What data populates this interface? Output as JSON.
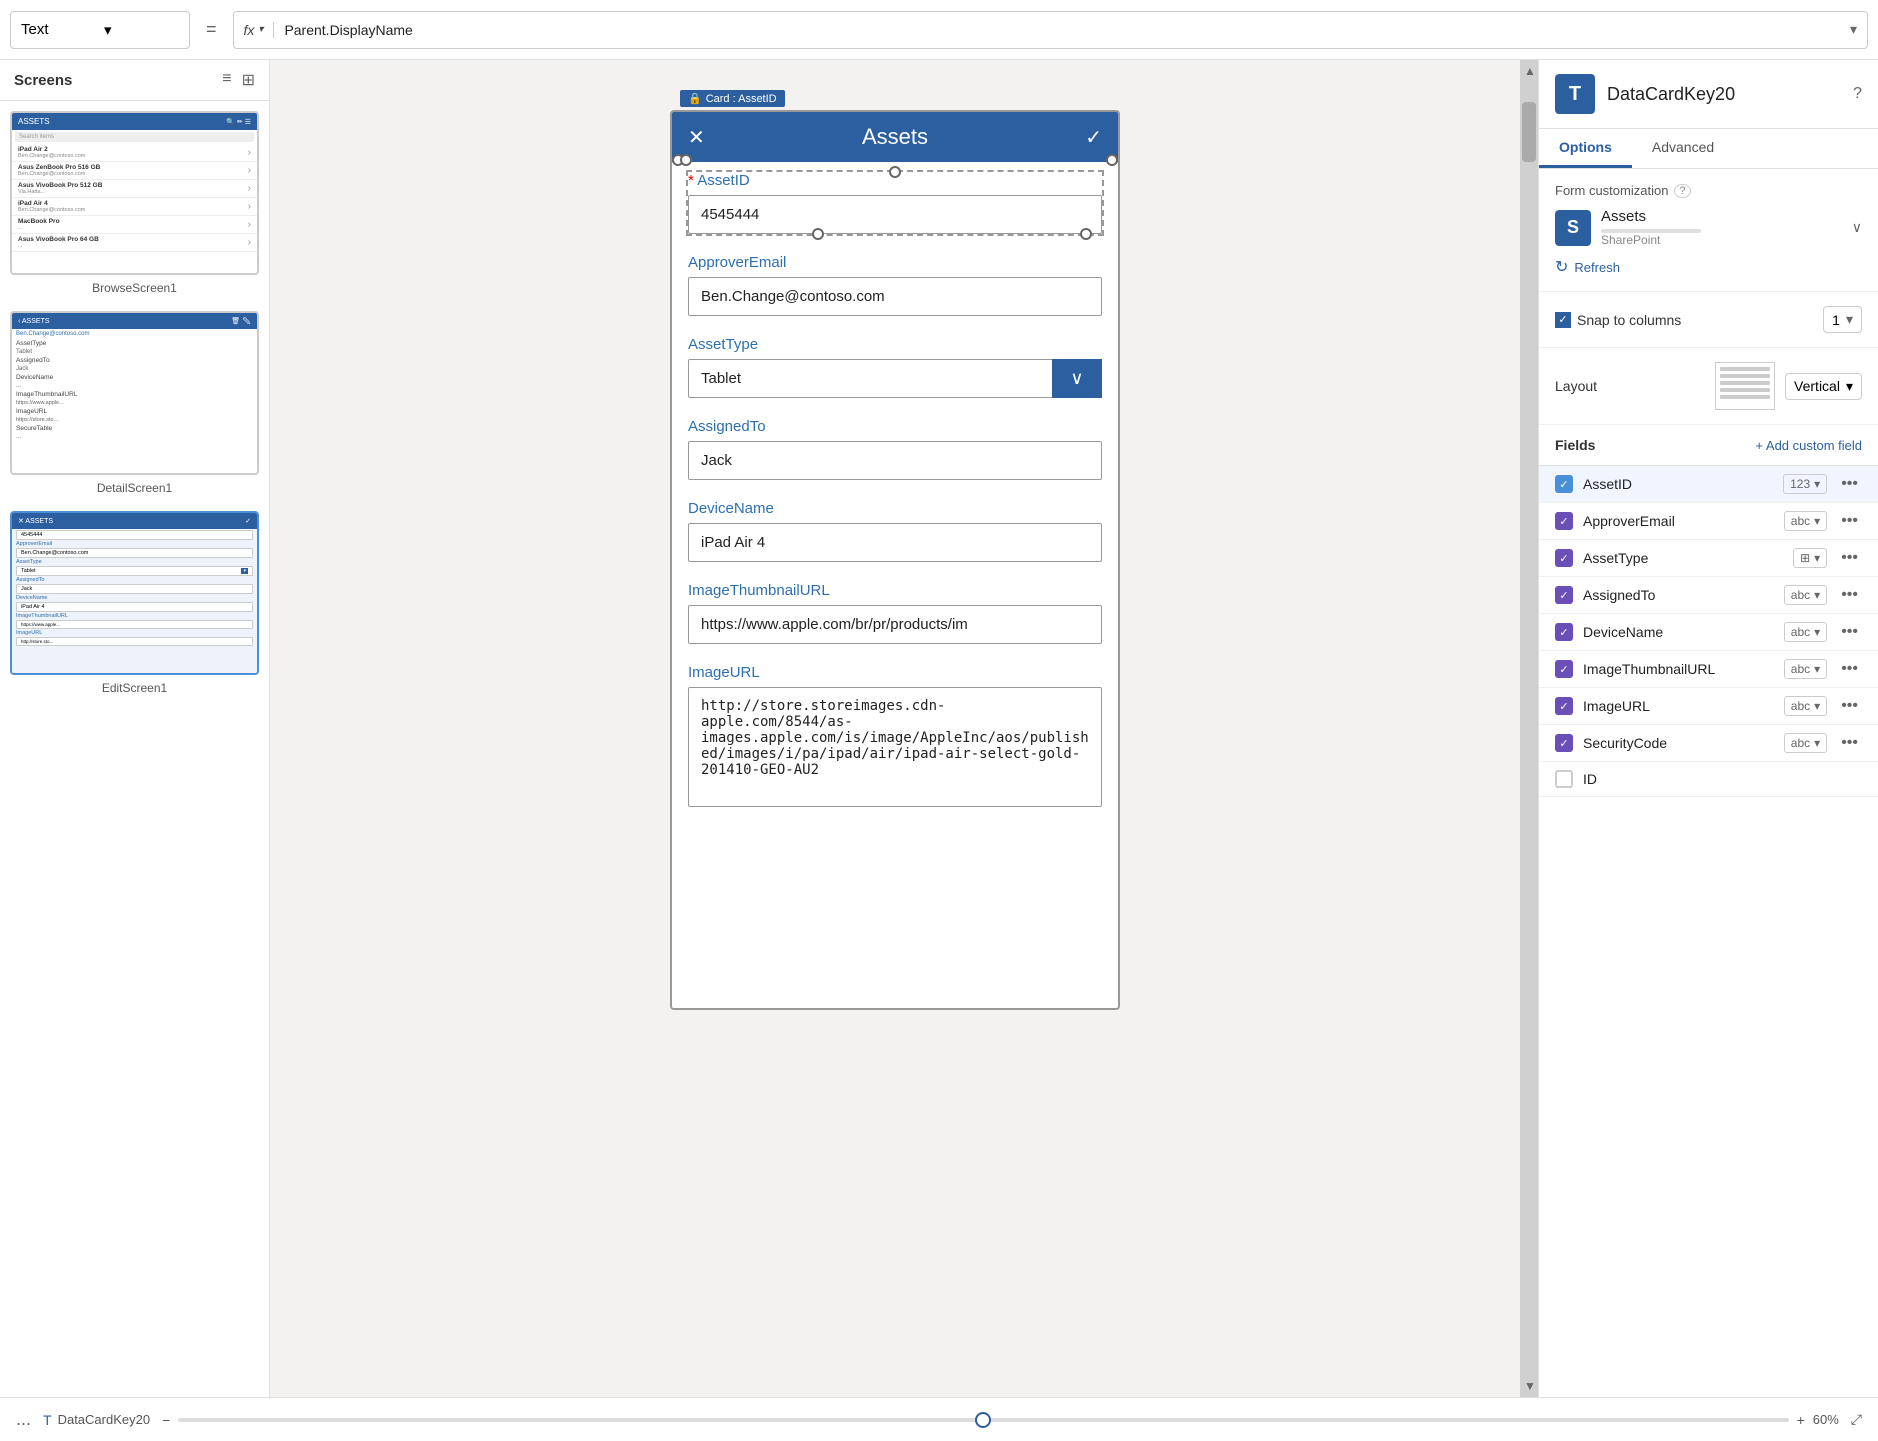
{
  "toolbar": {
    "formula_type": "Text",
    "formula_dropdown_arrow": "▾",
    "equals": "=",
    "fx_label": "fx",
    "fx_dropdown_arrow": "▾",
    "formula_value": "Parent.DisplayName",
    "formula_arrow": "▾"
  },
  "sidebar": {
    "title": "Screens",
    "list_icon": "≡",
    "grid_icon": "⊞",
    "screens": [
      {
        "name": "BrowseScreen1",
        "type": "browse"
      },
      {
        "name": "DetailScreen1",
        "type": "detail"
      },
      {
        "name": "EditScreen1",
        "type": "edit",
        "active": true
      }
    ]
  },
  "phone": {
    "card_badge": "Card : AssetID",
    "lock_icon": "🔒",
    "header_x": "✕",
    "header_title": "Assets",
    "header_check": "✓",
    "fields": [
      {
        "label": "AssetID",
        "required": true,
        "value": "4545444",
        "type": "input"
      },
      {
        "label": "ApproverEmail",
        "required": false,
        "value": "Ben.Change@contoso.com",
        "type": "input"
      },
      {
        "label": "AssetType",
        "required": false,
        "value": "Tablet",
        "type": "select"
      },
      {
        "label": "AssignedTo",
        "required": false,
        "value": "Jack",
        "type": "input"
      },
      {
        "label": "DeviceName",
        "required": false,
        "value": "iPad Air 4",
        "type": "input"
      },
      {
        "label": "ImageThumbnailURL",
        "required": false,
        "value": "https://www.apple.com/br/pr/products/im",
        "type": "input"
      },
      {
        "label": "ImageURL",
        "required": false,
        "value": "http://store.storeimages.cdn-apple.com/8544/as-images.apple.com/is/image/AppleInc/aos/published/images/i/pa/ipad/air/ipad-air-select-gold-201410-GEO-AU2",
        "type": "textarea"
      }
    ]
  },
  "right_panel": {
    "title": "DataCardKey20",
    "help_icon": "?",
    "tabs": [
      "Options",
      "Advanced"
    ],
    "active_tab": "Options",
    "form_customization_label": "Form customization",
    "help_circle": "?",
    "datasource": {
      "name": "Assets",
      "type": "SharePoint",
      "icon_letter": "S"
    },
    "expand_arrow": "∨",
    "refresh_label": "Refresh",
    "refresh_icon": "↻",
    "snap_label": "Snap to columns",
    "columns_value": "1",
    "layout_label": "Layout",
    "layout_value": "Vertical",
    "fields_title": "Fields",
    "add_custom_field": "+ Add custom field",
    "fields": [
      {
        "name": "AssetID",
        "type": "123",
        "checked": true,
        "highlight": true
      },
      {
        "name": "ApproverEmail",
        "type": "abc",
        "checked": true,
        "highlight": false
      },
      {
        "name": "AssetType",
        "type": "⊞",
        "checked": true,
        "highlight": false
      },
      {
        "name": "AssignedTo",
        "type": "abc",
        "checked": true,
        "highlight": false
      },
      {
        "name": "DeviceName",
        "type": "abc",
        "checked": true,
        "highlight": false
      },
      {
        "name": "ImageThumbnailURL",
        "type": "abc",
        "checked": true,
        "highlight": false
      },
      {
        "name": "ImageURL",
        "type": "abc",
        "checked": true,
        "highlight": false
      },
      {
        "name": "SecurityCode",
        "type": "abc",
        "checked": true,
        "highlight": false
      },
      {
        "name": "ID",
        "type": "",
        "checked": false,
        "highlight": false
      }
    ]
  },
  "bottom_bar": {
    "more_dots": "...",
    "component_icon": "T",
    "component_name": "DataCardKey20",
    "minus": "−",
    "plus": "+",
    "zoom": "60%",
    "expand_icon": "⤢"
  }
}
